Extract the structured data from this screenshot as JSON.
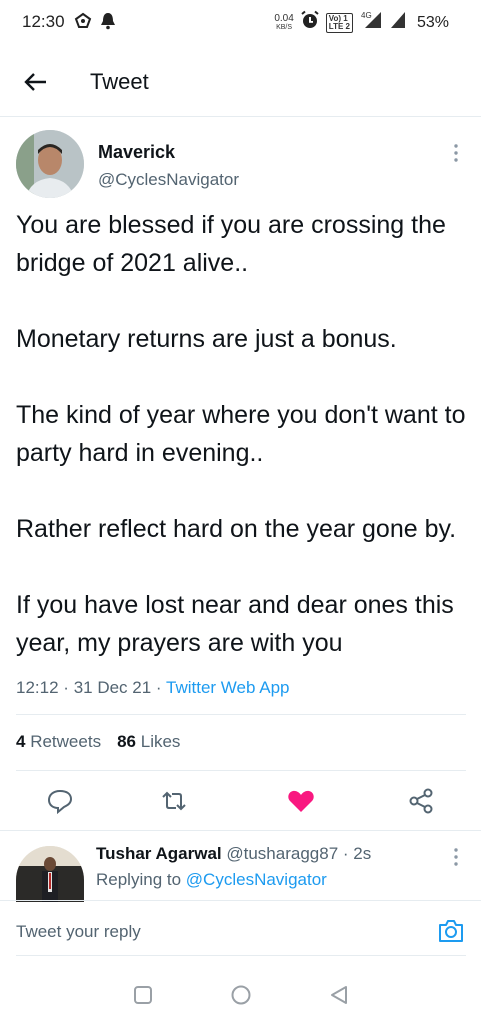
{
  "status_bar": {
    "time": "12:30",
    "net_speed_value": "0.04",
    "net_speed_unit": "KB/S",
    "volte_label": "Vo) 1\nLTE 2",
    "network_type": "4G",
    "battery": "53%",
    "icons": [
      "hotspot-icon",
      "notification-bell-icon",
      "alarm-icon",
      "signal-icon",
      "signal-icon"
    ]
  },
  "header": {
    "title": "Tweet",
    "back_icon": "arrow-left-icon"
  },
  "tweet": {
    "author_name": "Maverick",
    "author_handle": "@CyclesNavigator",
    "paragraphs": [
      "You are blessed if you are crossing the bridge of 2021 alive..",
      "Monetary returns are just a bonus.",
      "The kind of year where you don't want to party hard in evening..",
      "Rather reflect hard on the year gone by.",
      "If you have lost near and dear ones this year, my prayers are with you"
    ],
    "time": "12:12",
    "date": "31 Dec 21",
    "separator": "·",
    "source": "Twitter Web App",
    "retweets_count": "4",
    "retweets_label": "Retweets",
    "likes_count": "86",
    "likes_label": "Likes",
    "liked": true,
    "like_color": "#f91880"
  },
  "reply": {
    "name": "Tushar Agarwal",
    "handle": "@tusharagg87",
    "time_ago": "2s",
    "separator": "·",
    "replying_to_label": "Replying to",
    "replying_to_handle": "@CyclesNavigator"
  },
  "composer": {
    "placeholder": "Tweet your reply",
    "value": ""
  },
  "colors": {
    "accent": "#1d9bf0",
    "secondary_text": "#536471"
  }
}
